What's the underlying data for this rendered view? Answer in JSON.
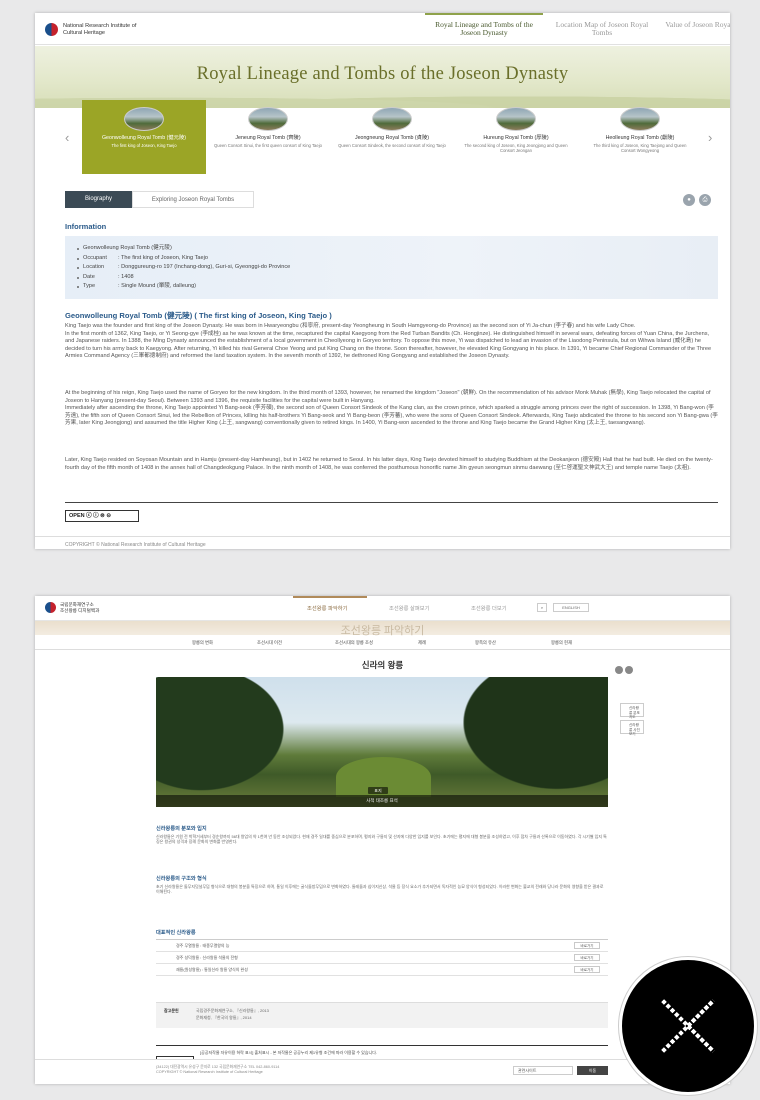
{
  "top": {
    "logo_text": "National Research Institute of Cultural Heritage",
    "nav": [
      {
        "label": "Royal Lineage and Tombs of the Joseon Dynasty",
        "active": true
      },
      {
        "label": "Location Map of Joseon Royal Tombs",
        "active": false
      },
      {
        "label": "Value of Joseon Royal Tombs",
        "active": false
      }
    ],
    "banner_title": "Royal Lineage and Tombs of the Joseon Dynasty",
    "carousel": [
      {
        "name": "Geonwolleung Royal Tomb (健元陵)",
        "sub": "The first king of Joseon, King Taejo"
      },
      {
        "name": "Jeneung Royal Tomb (齊陵)",
        "sub": "Queen Consort Sinui, the first queen consort of King Taejo"
      },
      {
        "name": "Jeongneung Royal Tomb (貞陵)",
        "sub": "Queen Consort Sindeok, the second consort of King Taejo"
      },
      {
        "name": "Hureung Royal Tomb (厚陵)",
        "sub": "The second king of Joseon, King Jeongjong and Queen Consort Jeongan"
      },
      {
        "name": "Heolleung Royal Tomb (獻陵)",
        "sub": "The third king of Joseon, King Taejong and Queen Consort Wongyeong"
      }
    ],
    "carousel_prev": "‹",
    "carousel_next": "›",
    "tabs": [
      "Biography",
      "Exploring Joseon Royal Tombs"
    ],
    "info_heading": "Information",
    "info": [
      {
        "key": "Geonwolleung Royal Tomb (健元陵)",
        "value": ""
      },
      {
        "key": "Occupant",
        "value": ": The first king of Joseon, King Taejo"
      },
      {
        "key": "Location",
        "value": ": Donggureung-ro 197 (Inchang-dong), Guri-si, Gyeonggi-do Province"
      },
      {
        "key": "Date",
        "value": ": 1408"
      },
      {
        "key": "Type",
        "value": ": Single Mound (單陵, dalleung)"
      }
    ],
    "sub_heading": "Geonwolleung Royal Tomb (健元陵) ( The first king of Joseon, King Taejo )",
    "paragraphs": [
      "King Taejo was the founder and first king of the Joseon Dynasty. He was born in Hwaryeongbu (和寧府, present-day Yeongheung in South Hamgyeong-do Province) as the second son of Yi Ja-chun (李子春) and his wife Lady Choe.\nIn the first month of 1362, King Taejo, or Yi Seong-gye (李成桂) as he was known at the time, recaptured the capital Kaegyong from the Red Turban Bandits (Ch. Hongjinze). He distinguished himself in several wars, defeating forces of Yuan China, the Jurchens, and Japanese raiders. In 1388, the Ming Dynasty announced the establishment of a local government in Cheollyeong in Goryeo territory. To oppose this move, Yi was dispatched to lead an invasion of the Liaodong Peninsula, but on Wihwa Island (威化島) he decided to turn his army back to Kaegyong.  After returning, Yi killed his rival General Choe Yeong and put King Chang on the throne. Soon thereafter, however, he elevated King Gongyang in his place. In 1391, Yi became Chief Regional Commander of the Three Armies Command Agency (三軍都摠制府) and reformed the land taxation system. In the seventh month of 1392, he dethroned King Gongyang and established the Joseon Dynasty.",
      "At the beginning of his reign, King Taejo used the name of Goryeo for the new kingdom. In the third month of 1393, however, he renamed the kingdom \"Joseon\" (朝鮮). On the recommendation of his advisor Monk Muhak (無學), King Taejo relocated the capital of Joseon to Hanyang (present-day Seoul). Between 1393 and 1396, the requisite facilities for the capital were built in Hanyang.\nImmediately after ascending the throne, King Taejo appointed Yi Bang-seok (李芳碩), the second son of Queen Consort Sindeok of the Kang clan, as the crown prince, which sparked a struggle among princes over the right of succession. In 1398, Yi Bang-won (李芳遠), the fifth son of Queen Consort Sinui, led the Rebellion of Princes, killing his half-brothers Yi Bang-seok and Yi Bang-beon (李芳蕃), who were the sons of Queen Consort Sindeok. Afterwards, King Taejo abdicated the throne to his second son Yi Bang-gwa (李芳果, later King Jeongjong) and assumed the title Higher King (上王, sangwang) conventionally given to retired kings. In 1400, Yi Bang-won ascended to the throne and King Taejo became the Grand Higher King (太上王, taesangwang).",
      "Later, King Taejo resided on Soyosan Mountain and in Hamju (present-day Hamheung), but in 1402 he returned to Seoul. In his latter days, King Taejo devoted himself to studying Buddhism at the Deokanjeon (德安殿) Hall that he had built. He died on the twenty-fourth day of the fifth month of 1408 in the annex hall of Changdeokgung Palace. In the ninth month of 1408, he was conferred the posthumous honorific name Jiin gyeun seongmun sinmu daewang (至仁啓運聖文神武大王) and temple name Taejo (太祖)."
    ],
    "license": "OPEN",
    "copyright": "COPYRIGHT © National Research Institute of Cultural Heritage"
  },
  "bottom": {
    "logo_text": "국립문화재연구소\n조선왕릉 디지털백과",
    "nav": [
      "조선왕릉 파악하기",
      "조선왕릉 살펴보기",
      "조선왕릉 더보기"
    ],
    "lang": "ENGLISH",
    "banner_title": "조선왕릉 파악하기",
    "subnav": [
      "왕릉의 변화",
      "조선시대 이전",
      "조선시대의 왕릉 조성",
      "제례",
      "왕족의 유산",
      "왕릉의 현재"
    ],
    "page_title": "신라의 왕릉",
    "photo_caption": "사적 태조릉 표석",
    "photo_tag": "표지",
    "side_tabs": [
      "신라왕릉 분포지도",
      "신라왕릉 사진보기"
    ],
    "h1": "신라왕릉의 분포와 입지",
    "p1": "신라왕릉은 기원 전 박혁거세부터 경순왕까지 56대 왕업의 약 1천여 년 동안 조성되었다. 현재 경주 일대를 중심으로 분포하며, 평지와 구릉지 및 산지에 다양한 입지를 보인다. 초기에는 평지에 대형 봉분을 조성하였고, 이후 점차 구릉과 산록으로 이동하였다. 각 시기별 입지 특징은 왕권의 성격과 장례 문화의 변화를 반영한다.",
    "h2": "신라왕릉의 구조와 형식",
    "p2": "초기 신라왕릉은 돌무지덧널무덤 형식으로 대형의 봉분을 특징으로 하며, 통일 이후에는 굴식돌방무덤으로 변화하였다. 둘레돌과 십이지신상, 석물 등 장식 요소가 추가되면서 독자적인 능묘 양식이 형성되었다. 이러한 변화는 불교의 전래와 당나라 문화의 영향을 받은 결과로 이해된다.",
    "h3": "대표적인 신라왕릉",
    "list": [
      {
        "title": "경주 무열왕릉 : 태종무열왕의 능",
        "btn": "바로가기"
      },
      {
        "title": "경주 성덕왕릉 : 신라왕릉 석물의 전형",
        "btn": "바로가기"
      },
      {
        "title": "괘릉(원성왕릉) : 통일신라 왕릉 양식의 완성",
        "btn": "바로가기"
      }
    ],
    "ref_label": "참고문헌",
    "refs": [
      "국립경주문화재연구소, 『신라왕릉』, 2013",
      "문화재청, 『한국의 왕릉』, 2014"
    ],
    "kogl": "OPEN",
    "kogl_text": "[공공저작물 자유이용 허락 표시] 출처표시 - 본 저작물은 공공누리 제1유형 조건에 따라 이용할 수 있습니다.",
    "footer": "(34122) 대전광역시 유성구 문지로 132 국립문화재연구소 TEL 042-860-9114\nCOPYRIGHT © National Research Institute of Cultural Heritage",
    "family_select": "관련사이트",
    "go": "이동"
  },
  "close_icon": "close-x-icon"
}
